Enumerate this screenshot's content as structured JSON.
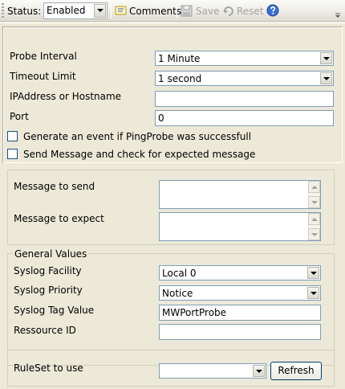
{
  "toolbar": {
    "status_label": "Status:",
    "status_value": "Enabled",
    "comments_label": "Comments",
    "save_label": "Save",
    "reset_label": "Reset"
  },
  "form": {
    "probe_interval_label": "Probe Interval",
    "probe_interval_value": "1 Minute",
    "timeout_limit_label": "Timeout Limit",
    "timeout_limit_value": "1 second",
    "host_label": "IPAddress or Hostname",
    "host_value": "",
    "port_label": "Port",
    "port_value": "0",
    "generate_event_label": "Generate an event if PingProbe was successfull",
    "send_message_label": "Send Message and check for expected message",
    "message_to_send_label": "Message to send",
    "message_to_expect_label": "Message to expect"
  },
  "general_values": {
    "legend": "General Values",
    "syslog_facility_label": "Syslog Facility",
    "syslog_facility_value": "Local 0",
    "syslog_priority_label": "Syslog Priority",
    "syslog_priority_value": "Notice",
    "syslog_tag_label": "Syslog Tag Value",
    "syslog_tag_value": "MWPortProbe",
    "ressource_id_label": "Ressource ID",
    "ressource_id_value": ""
  },
  "ruleset": {
    "label": "RuleSet to use",
    "value": "",
    "refresh_label": "Refresh"
  }
}
